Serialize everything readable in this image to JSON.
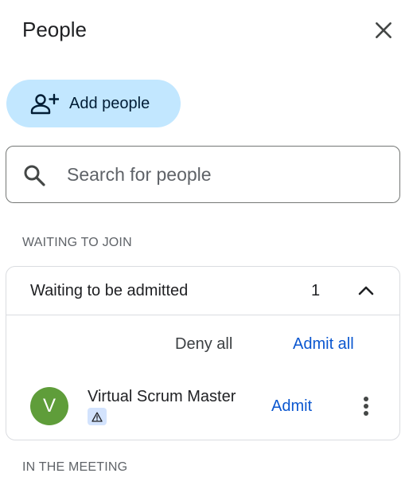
{
  "header": {
    "title": "People",
    "close_icon": "close-icon"
  },
  "add_people": {
    "label": "Add people",
    "icon": "person-add-icon",
    "background": "#c2e7ff"
  },
  "search": {
    "placeholder": "Search for people",
    "value": "",
    "icon": "search-icon"
  },
  "waiting_section": {
    "heading": "WAITING TO JOIN",
    "card": {
      "label": "Waiting to be admitted",
      "count": "1",
      "collapse_icon": "chevron-up-icon",
      "deny_all_label": "Deny all",
      "admit_all_label": "Admit all",
      "people": [
        {
          "initial": "V",
          "name": "Virtual Scrum Master",
          "avatar_color": "#5f9d3a",
          "badge_icon": "warning-icon",
          "admit_label": "Admit",
          "more_icon": "more-vert-icon"
        }
      ]
    }
  },
  "meeting_section": {
    "heading": "IN THE MEETING"
  },
  "colors": {
    "accent": "#0b57d0",
    "text": "#202124",
    "muted": "#5f6368",
    "border": "#dadce0"
  }
}
